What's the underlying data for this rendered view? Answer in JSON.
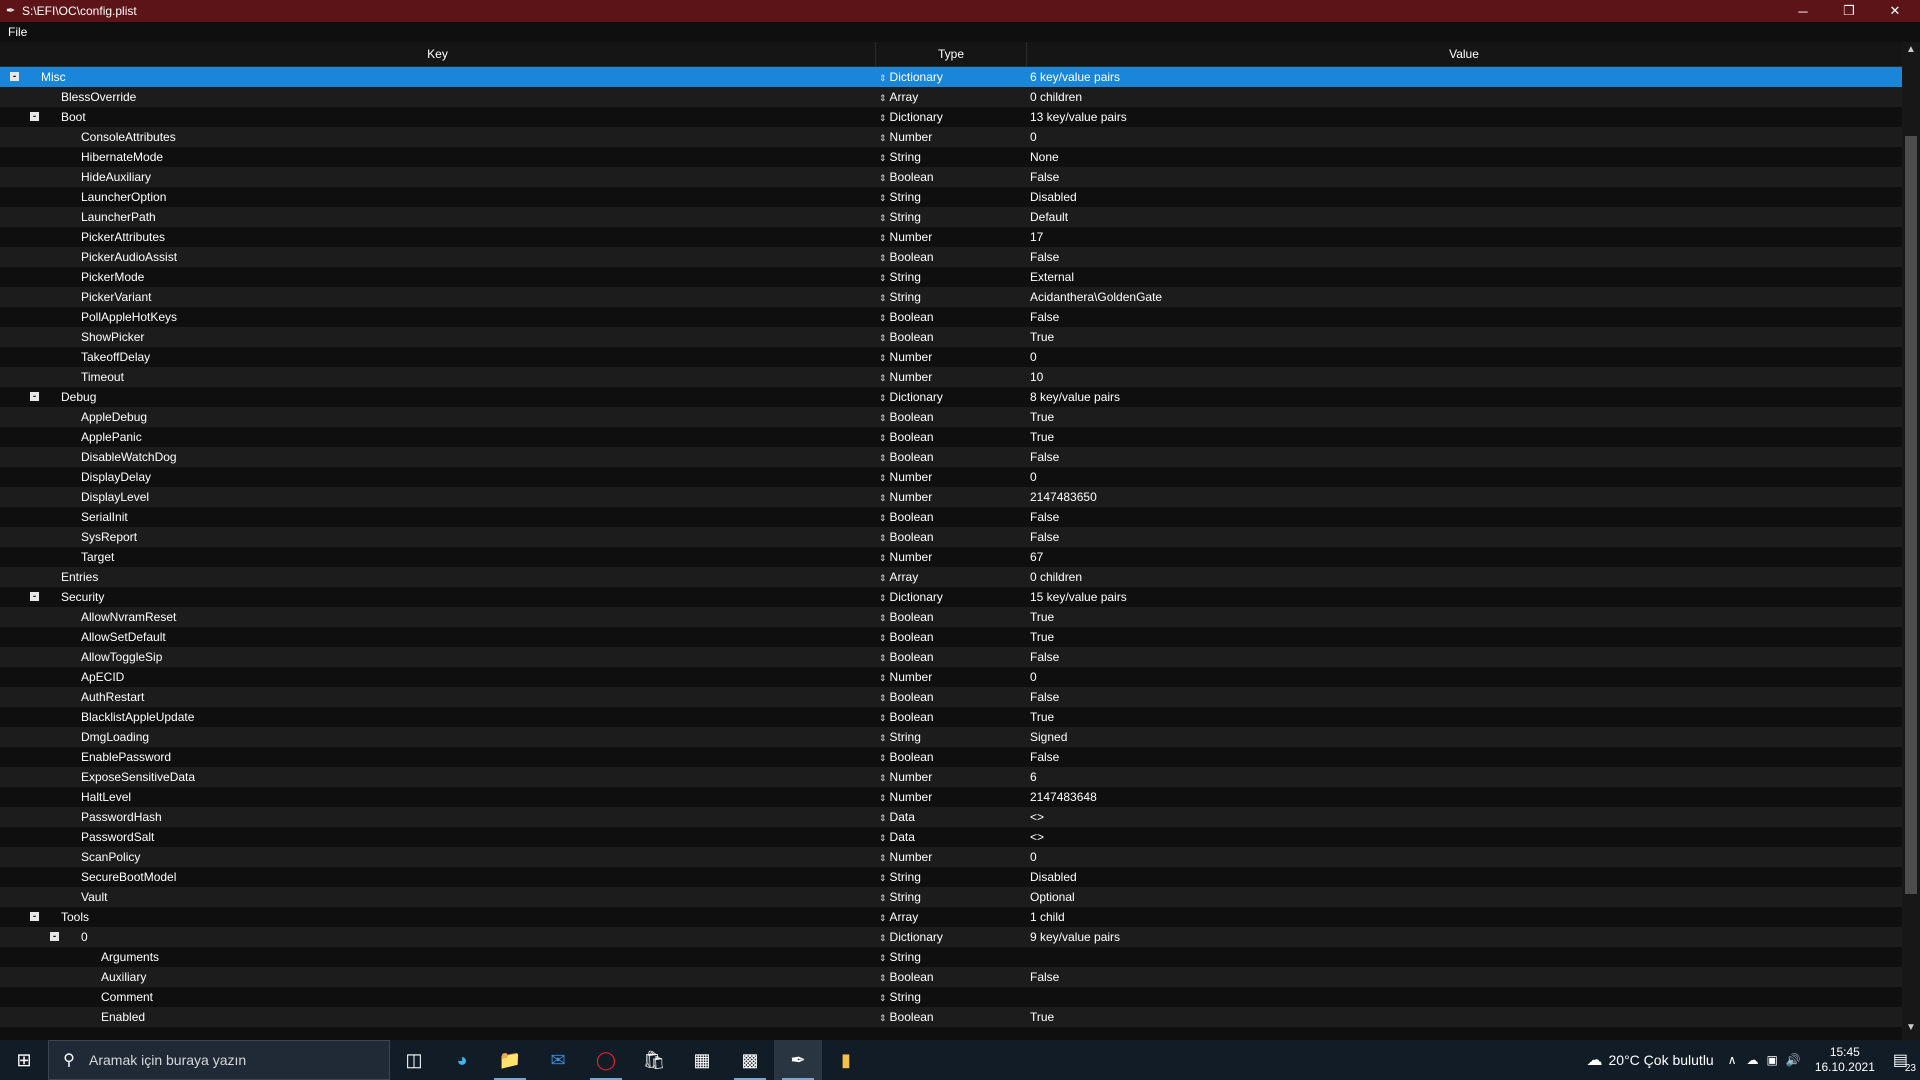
{
  "window": {
    "title": "S:\\EFI\\OC\\config.plist",
    "controls": {
      "minimize": "─",
      "maximize": "❐",
      "close": "✕"
    }
  },
  "menu": {
    "file": "File"
  },
  "columns": {
    "key": "Key",
    "type": "Type",
    "value": "Value"
  },
  "rows": [
    {
      "key": "Misc",
      "type": "Dictionary",
      "value": "6 key/value pairs",
      "depth": 0,
      "expand": "-",
      "selected": true
    },
    {
      "key": "BlessOverride",
      "type": "Array",
      "value": "0 children",
      "depth": 1
    },
    {
      "key": "Boot",
      "type": "Dictionary",
      "value": "13 key/value pairs",
      "depth": 1,
      "expand": "-"
    },
    {
      "key": "ConsoleAttributes",
      "type": "Number",
      "value": "0",
      "depth": 2
    },
    {
      "key": "HibernateMode",
      "type": "String",
      "value": "None",
      "depth": 2
    },
    {
      "key": "HideAuxiliary",
      "type": "Boolean",
      "value": "False",
      "depth": 2
    },
    {
      "key": "LauncherOption",
      "type": "String",
      "value": "Disabled",
      "depth": 2
    },
    {
      "key": "LauncherPath",
      "type": "String",
      "value": "Default",
      "depth": 2
    },
    {
      "key": "PickerAttributes",
      "type": "Number",
      "value": "17",
      "depth": 2
    },
    {
      "key": "PickerAudioAssist",
      "type": "Boolean",
      "value": "False",
      "depth": 2
    },
    {
      "key": "PickerMode",
      "type": "String",
      "value": "External",
      "depth": 2
    },
    {
      "key": "PickerVariant",
      "type": "String",
      "value": "Acidanthera\\GoldenGate",
      "depth": 2
    },
    {
      "key": "PollAppleHotKeys",
      "type": "Boolean",
      "value": "False",
      "depth": 2
    },
    {
      "key": "ShowPicker",
      "type": "Boolean",
      "value": "True",
      "depth": 2
    },
    {
      "key": "TakeoffDelay",
      "type": "Number",
      "value": "0",
      "depth": 2
    },
    {
      "key": "Timeout",
      "type": "Number",
      "value": "10",
      "depth": 2
    },
    {
      "key": "Debug",
      "type": "Dictionary",
      "value": "8 key/value pairs",
      "depth": 1,
      "expand": "-"
    },
    {
      "key": "AppleDebug",
      "type": "Boolean",
      "value": "True",
      "depth": 2
    },
    {
      "key": "ApplePanic",
      "type": "Boolean",
      "value": "True",
      "depth": 2
    },
    {
      "key": "DisableWatchDog",
      "type": "Boolean",
      "value": "False",
      "depth": 2
    },
    {
      "key": "DisplayDelay",
      "type": "Number",
      "value": "0",
      "depth": 2
    },
    {
      "key": "DisplayLevel",
      "type": "Number",
      "value": "2147483650",
      "depth": 2
    },
    {
      "key": "SerialInit",
      "type": "Boolean",
      "value": "False",
      "depth": 2
    },
    {
      "key": "SysReport",
      "type": "Boolean",
      "value": "False",
      "depth": 2
    },
    {
      "key": "Target",
      "type": "Number",
      "value": "67",
      "depth": 2
    },
    {
      "key": "Entries",
      "type": "Array",
      "value": "0 children",
      "depth": 1
    },
    {
      "key": "Security",
      "type": "Dictionary",
      "value": "15 key/value pairs",
      "depth": 1,
      "expand": "-"
    },
    {
      "key": "AllowNvramReset",
      "type": "Boolean",
      "value": "True",
      "depth": 2
    },
    {
      "key": "AllowSetDefault",
      "type": "Boolean",
      "value": "True",
      "depth": 2
    },
    {
      "key": "AllowToggleSip",
      "type": "Boolean",
      "value": "False",
      "depth": 2
    },
    {
      "key": "ApECID",
      "type": "Number",
      "value": "0",
      "depth": 2
    },
    {
      "key": "AuthRestart",
      "type": "Boolean",
      "value": "False",
      "depth": 2
    },
    {
      "key": "BlacklistAppleUpdate",
      "type": "Boolean",
      "value": "True",
      "depth": 2
    },
    {
      "key": "DmgLoading",
      "type": "String",
      "value": "Signed",
      "depth": 2
    },
    {
      "key": "EnablePassword",
      "type": "Boolean",
      "value": "False",
      "depth": 2
    },
    {
      "key": "ExposeSensitiveData",
      "type": "Number",
      "value": "6",
      "depth": 2
    },
    {
      "key": "HaltLevel",
      "type": "Number",
      "value": "2147483648",
      "depth": 2
    },
    {
      "key": "PasswordHash",
      "type": "Data",
      "value": "<>",
      "depth": 2
    },
    {
      "key": "PasswordSalt",
      "type": "Data",
      "value": "<>",
      "depth": 2
    },
    {
      "key": "ScanPolicy",
      "type": "Number",
      "value": "0",
      "depth": 2
    },
    {
      "key": "SecureBootModel",
      "type": "String",
      "value": "Disabled",
      "depth": 2
    },
    {
      "key": "Vault",
      "type": "String",
      "value": "Optional",
      "depth": 2
    },
    {
      "key": "Tools",
      "type": "Array",
      "value": "1 child",
      "depth": 1,
      "expand": "-"
    },
    {
      "key": "0",
      "type": "Dictionary",
      "value": "9 key/value pairs",
      "depth": 2,
      "expand": "-"
    },
    {
      "key": "Arguments",
      "type": "String",
      "value": "",
      "depth": 3
    },
    {
      "key": "Auxiliary",
      "type": "Boolean",
      "value": "False",
      "depth": 3
    },
    {
      "key": "Comment",
      "type": "String",
      "value": "",
      "depth": 3
    },
    {
      "key": "Enabled",
      "type": "Boolean",
      "value": "True",
      "depth": 3
    }
  ],
  "taskbar": {
    "search_placeholder": "Aramak için buraya yazın",
    "weather": "20°C  Çok bulutlu",
    "time": "15:45",
    "date": "16.10.2021",
    "notification_count": "23"
  },
  "colors": {
    "titlebar": "#5c1418",
    "selection": "#1a86d9",
    "taskbar": "#121c26"
  }
}
